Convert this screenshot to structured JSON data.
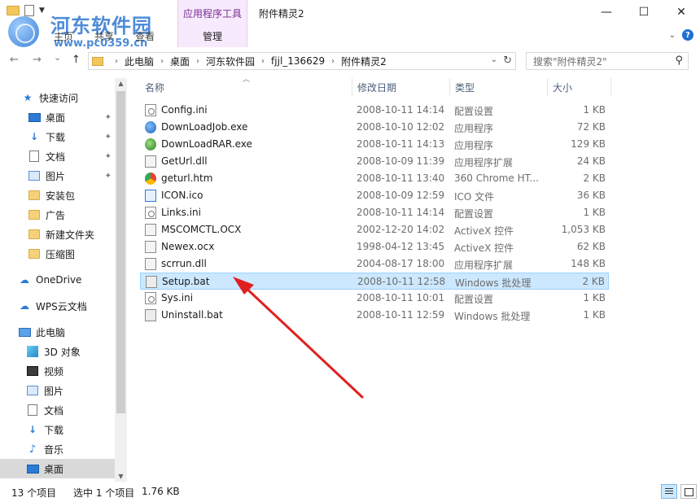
{
  "window": {
    "title": "附件精灵2",
    "contextual_tab_group": "应用程序工具",
    "contextual_tab": "管理",
    "ribbon_tabs": [
      "主页",
      "共享",
      "查看"
    ],
    "minimize_icon": "—",
    "maximize_icon": "☐",
    "close_icon": "✕"
  },
  "watermark": {
    "title": "河东软件园",
    "url": "www.pc0359.cn"
  },
  "nav": {
    "back": "←",
    "forward": "→",
    "recent": "⌄",
    "up": "↑"
  },
  "address": {
    "crumbs": [
      "此电脑",
      "桌面",
      "河东软件园",
      "fjjl_136629",
      "附件精灵2"
    ],
    "refresh": "↻"
  },
  "search": {
    "placeholder": "搜索\"附件精灵2\""
  },
  "sidebar": {
    "items": [
      {
        "label": "快速访问",
        "icon": "star-icon"
      },
      {
        "label": "桌面",
        "icon": "desktop-icon",
        "pinned": true
      },
      {
        "label": "下载",
        "icon": "download-icon",
        "pinned": true
      },
      {
        "label": "文档",
        "icon": "document-icon",
        "pinned": true
      },
      {
        "label": "图片",
        "icon": "picture-icon",
        "pinned": true
      },
      {
        "label": "安装包",
        "icon": "folder-icon"
      },
      {
        "label": "广告",
        "icon": "folder-icon"
      },
      {
        "label": "新建文件夹",
        "icon": "folder-icon"
      },
      {
        "label": "压缩图",
        "icon": "folder-icon"
      },
      {
        "label": "OneDrive",
        "icon": "cloud-icon"
      },
      {
        "label": "WPS云文档",
        "icon": "cloud-icon"
      },
      {
        "label": "此电脑",
        "icon": "computer-icon"
      },
      {
        "label": "3D 对象",
        "icon": "3d-objects-icon"
      },
      {
        "label": "视频",
        "icon": "video-icon"
      },
      {
        "label": "图片",
        "icon": "picture-icon"
      },
      {
        "label": "文档",
        "icon": "document-icon"
      },
      {
        "label": "下载",
        "icon": "download-icon"
      },
      {
        "label": "音乐",
        "icon": "music-icon"
      },
      {
        "label": "桌面",
        "icon": "desktop-icon"
      }
    ],
    "pin_glyph": "📌"
  },
  "columns": {
    "name": "名称",
    "date": "修改日期",
    "type": "类型",
    "size": "大小"
  },
  "files": [
    {
      "name": "Config.ini",
      "date": "2008-10-11 14:14",
      "type": "配置设置",
      "size": "1 KB",
      "icon": "ini-file-icon"
    },
    {
      "name": "DownLoadJob.exe",
      "date": "2008-10-10 12:02",
      "type": "应用程序",
      "size": "72 KB",
      "icon": "exe-file-icon"
    },
    {
      "name": "DownLoadRAR.exe",
      "date": "2008-10-11 14:13",
      "type": "应用程序",
      "size": "129 KB",
      "icon": "exe-file-icon"
    },
    {
      "name": "GetUrl.dll",
      "date": "2008-10-09 11:39",
      "type": "应用程序扩展",
      "size": "24 KB",
      "icon": "dll-file-icon"
    },
    {
      "name": "geturl.htm",
      "date": "2008-10-11 13:40",
      "type": "360 Chrome HT...",
      "size": "2 KB",
      "icon": "htm-file-icon"
    },
    {
      "name": "ICON.ico",
      "date": "2008-10-09 12:59",
      "type": "ICO 文件",
      "size": "36 KB",
      "icon": "ico-file-icon"
    },
    {
      "name": "Links.ini",
      "date": "2008-10-11 14:14",
      "type": "配置设置",
      "size": "1 KB",
      "icon": "ini-file-icon"
    },
    {
      "name": "MSCOMCTL.OCX",
      "date": "2002-12-20 14:02",
      "type": "ActiveX 控件",
      "size": "1,053 KB",
      "icon": "ocx-file-icon"
    },
    {
      "name": "Newex.ocx",
      "date": "1998-04-12 13:45",
      "type": "ActiveX 控件",
      "size": "62 KB",
      "icon": "ocx-file-icon"
    },
    {
      "name": "scrrun.dll",
      "date": "2004-08-17 18:00",
      "type": "应用程序扩展",
      "size": "148 KB",
      "icon": "dll-file-icon"
    },
    {
      "name": "Setup.bat",
      "date": "2008-10-11 12:58",
      "type": "Windows 批处理",
      "size": "2 KB",
      "icon": "bat-file-icon",
      "selected": true
    },
    {
      "name": "Sys.ini",
      "date": "2008-10-11 10:01",
      "type": "配置设置",
      "size": "1 KB",
      "icon": "ini-file-icon"
    },
    {
      "name": "Uninstall.bat",
      "date": "2008-10-11 12:59",
      "type": "Windows 批处理",
      "size": "1 KB",
      "icon": "bat-file-icon"
    }
  ],
  "status": {
    "count": "13 个项目",
    "selection": "选中 1 个项目",
    "selection_size": "1.76 KB"
  },
  "colors": {
    "selection": "#cce8ff",
    "selection_border": "#99d1ff",
    "arrow": "#e02020",
    "accent": "#2b7bd6"
  }
}
